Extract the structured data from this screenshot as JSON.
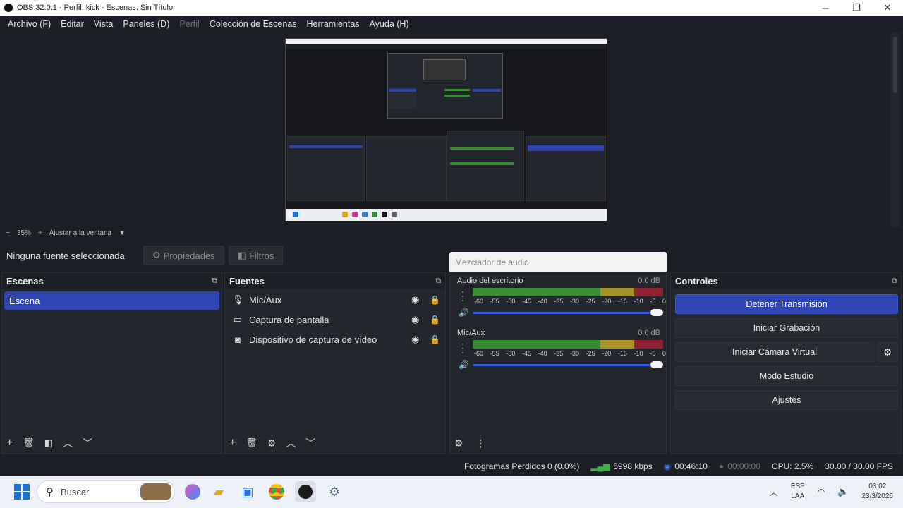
{
  "window": {
    "title": "OBS 32.0.1 - Perfil: kick - Escenas: Sin Título",
    "controls": [
      "─",
      "❐",
      "✕"
    ]
  },
  "menu": [
    {
      "label": "Archivo (F)",
      "enabled": true
    },
    {
      "label": "Editar",
      "enabled": true
    },
    {
      "label": "Vista",
      "enabled": true
    },
    {
      "label": "Paneles (D)",
      "enabled": true
    },
    {
      "label": "Perfil",
      "enabled": false
    },
    {
      "label": "Colección de Escenas",
      "enabled": true
    },
    {
      "label": "Herramientas",
      "enabled": true
    },
    {
      "label": "Ayuda (H)",
      "enabled": true
    }
  ],
  "zoom": {
    "minus": "−",
    "value": "35%",
    "plus": "+",
    "fit": "Ajustar a la ventana",
    "arrow": "▼"
  },
  "source_toolbar": {
    "no_source": "Ninguna fuente seleccionada",
    "properties": "Propiedades",
    "filters": "Filtros"
  },
  "scenes": {
    "title": "Escenas",
    "items": [
      "Escena"
    ]
  },
  "sources": {
    "title": "Fuentes",
    "items": [
      {
        "label": "Mic/Aux",
        "icon": "microphone-icon",
        "glyph": "🎙"
      },
      {
        "label": "Captura de pantalla",
        "icon": "monitor-icon",
        "glyph": "▭"
      },
      {
        "label": "Dispositivo de captura de vídeo",
        "icon": "camera-icon",
        "glyph": "◙"
      }
    ]
  },
  "mixer": {
    "title": "Mezclador de audio",
    "scale": [
      "-60",
      "-55",
      "-50",
      "-45",
      "-40",
      "-35",
      "-30",
      "-25",
      "-20",
      "-15",
      "-10",
      "-5",
      "0"
    ],
    "channels": [
      {
        "name": "Audio del escritorio",
        "db": "0.0 dB",
        "volume": 1.0
      },
      {
        "name": "Mic/Aux",
        "db": "0.0 dB",
        "volume": 1.0
      }
    ]
  },
  "controls": {
    "title": "Controles",
    "stop_stream": "Detener Transmisión",
    "start_recording": "Iniciar Grabación",
    "start_virtual_cam": "Iniciar Cámara Virtual",
    "studio_mode": "Modo Estudio",
    "settings": "Ajustes"
  },
  "status": {
    "dropped_frames": "Fotogramas Perdidos 0 (0.0%)",
    "bitrate": "5998 kbps",
    "stream_time": "00:46:10",
    "record_time": "00:00:00",
    "cpu": "CPU: 2.5%",
    "fps": "30.00 / 30.00 FPS"
  },
  "taskbar": {
    "search_placeholder": "Buscar",
    "lang_top": "ESP",
    "lang_bottom": "LAA",
    "time": "03:02",
    "date": "23/3/2026"
  },
  "colors": {
    "accent": "#2f45b5",
    "background": "#1d1f26",
    "panel": "#24262d",
    "meter_green": "#3a8a36",
    "meter_yellow": "#a9912a",
    "meter_red": "#8e2233"
  }
}
